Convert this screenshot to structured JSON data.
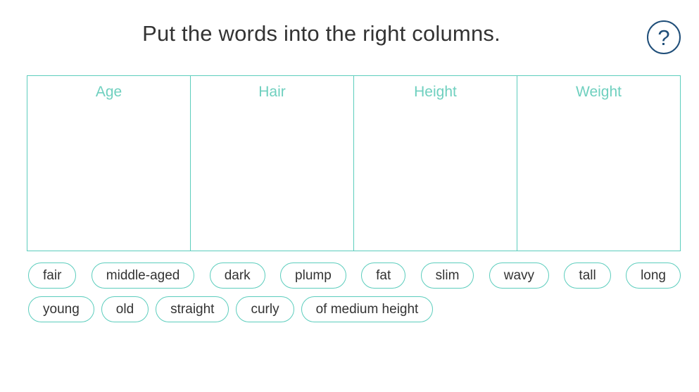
{
  "instruction": "Put the words into the right columns.",
  "help": {
    "label": "?"
  },
  "columns": [
    {
      "label": "Age"
    },
    {
      "label": "Hair"
    },
    {
      "label": "Height"
    },
    {
      "label": "Weight"
    }
  ],
  "word_bank": {
    "row1": [
      "fair",
      "middle-aged",
      "dark",
      "plump",
      "fat",
      "slim",
      "wavy",
      "tall",
      "long"
    ],
    "row2": [
      "young",
      "old",
      "straight",
      "curly",
      "of medium height"
    ]
  },
  "colors": {
    "accent": "#5ccdbd",
    "header_text": "#6fd0bf",
    "help_button": "#1f4e79"
  }
}
